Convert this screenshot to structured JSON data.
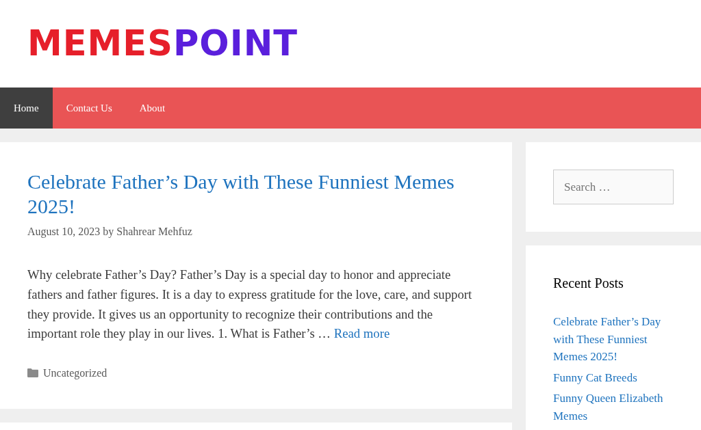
{
  "logo": {
    "parts": [
      {
        "text": "MEMES",
        "color": "#e61f2a"
      },
      {
        "text": "POINT",
        "color": "#5a1fdc"
      }
    ]
  },
  "nav": [
    {
      "label": "Home",
      "selected": true
    },
    {
      "label": "Contact Us",
      "selected": false
    },
    {
      "label": "About",
      "selected": false
    }
  ],
  "post": {
    "title": "Celebrate Father’s Day with These Funniest Memes 2025!",
    "date": "August 10, 2023",
    "by": "by",
    "author": "Shahrear Mehfuz",
    "excerpt": "Why celebrate Father’s Day? Father’s Day is a special day to honor and appreciate fathers and father figures. It is a day to express gratitude for the love, care, and support they provide. It gives us an opportunity to recognize their contributions and the important role they play in our lives. 1. What is Father’s …",
    "read_more": "Read more",
    "category": "Uncategorized"
  },
  "sidebar": {
    "search": {
      "placeholder": "Search …"
    },
    "recent_posts": {
      "title": "Recent Posts",
      "items": [
        "Celebrate Father’s Day with These Funniest Memes 2025!",
        "Funny Cat Breeds",
        "Funny Queen Elizabeth Memes"
      ]
    }
  }
}
